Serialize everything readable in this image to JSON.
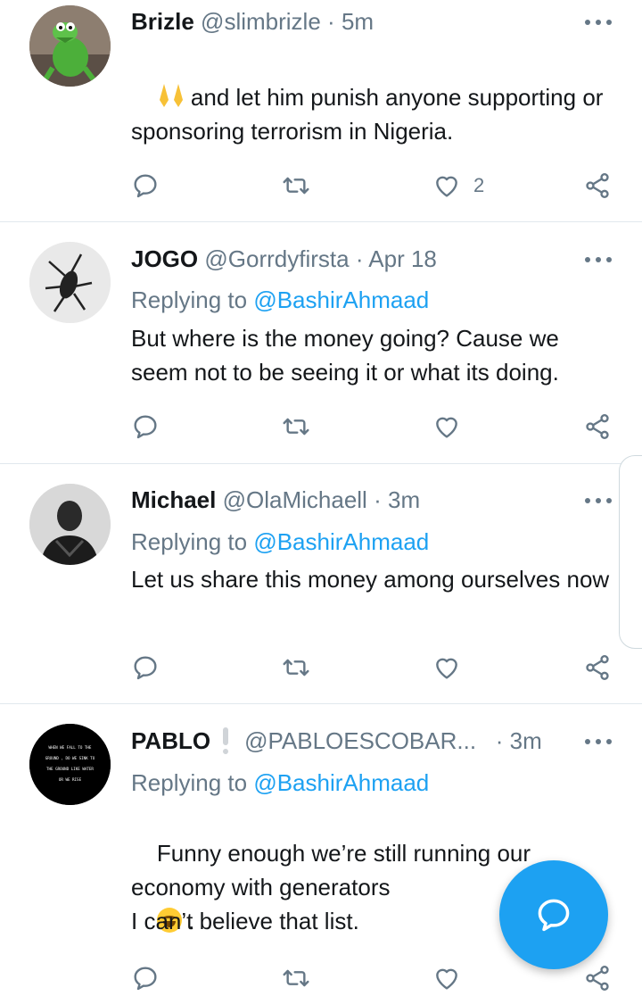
{
  "tweets": [
    {
      "name": "Brizle",
      "handle": "@slimbrizle",
      "time": "5m",
      "avatar_icon": "kermit-avatar-image",
      "text_prefix_emoji": "folded-hands-emoji",
      "text": "and let him punish anyone supporting or sponsoring terrorism in Nigeria.",
      "like_count": "2"
    },
    {
      "name": "JOGO",
      "handle": "@Gorrdyfirsta",
      "time": "Apr 18",
      "avatar_icon": "insect-avatar-image",
      "replying_label": "Replying to",
      "replying_to": "@BashirAhmaad",
      "text": "But where is the money going? Cause we seem not to be seeing it or what its doing."
    },
    {
      "name": "Michael",
      "handle": "@OlaMichaell",
      "time": "3m",
      "avatar_icon": "person-avatar-image",
      "replying_label": "Replying to",
      "replying_to": "@BashirAhmaad",
      "text": "Let us share this money among ourselves now"
    },
    {
      "name": "PABLO",
      "handle": "@PABLOESCOBAR...",
      "time": "3m",
      "avatar_icon": "quote-text-avatar-image",
      "avatar_text": [
        "WHEN WE FALL TO THE",
        "GROUND , DO WE SINK TO",
        "THE GROUND LIKE WATER",
        "OR WE RISE"
      ],
      "replying_label": "Replying to",
      "replying_to": "@BashirAhmaad",
      "text_line1": "Funny enough we’re still running our economy with generators",
      "text_emoji": "tears-of-joy-emoji",
      "text_line1_end": " .",
      "text_line2": "I can’t believe that list."
    }
  ],
  "actions": {
    "reply_icon": "reply-icon",
    "retweet_icon": "retweet-icon",
    "like_icon": "heart-icon",
    "share_icon": "share-icon"
  },
  "separator": "·",
  "fab_icon": "compose-reply-icon",
  "colors": {
    "accent": "#1da1f2",
    "secondary_text": "#657786",
    "primary_text": "#14171a",
    "divider": "#e1e8ed"
  }
}
